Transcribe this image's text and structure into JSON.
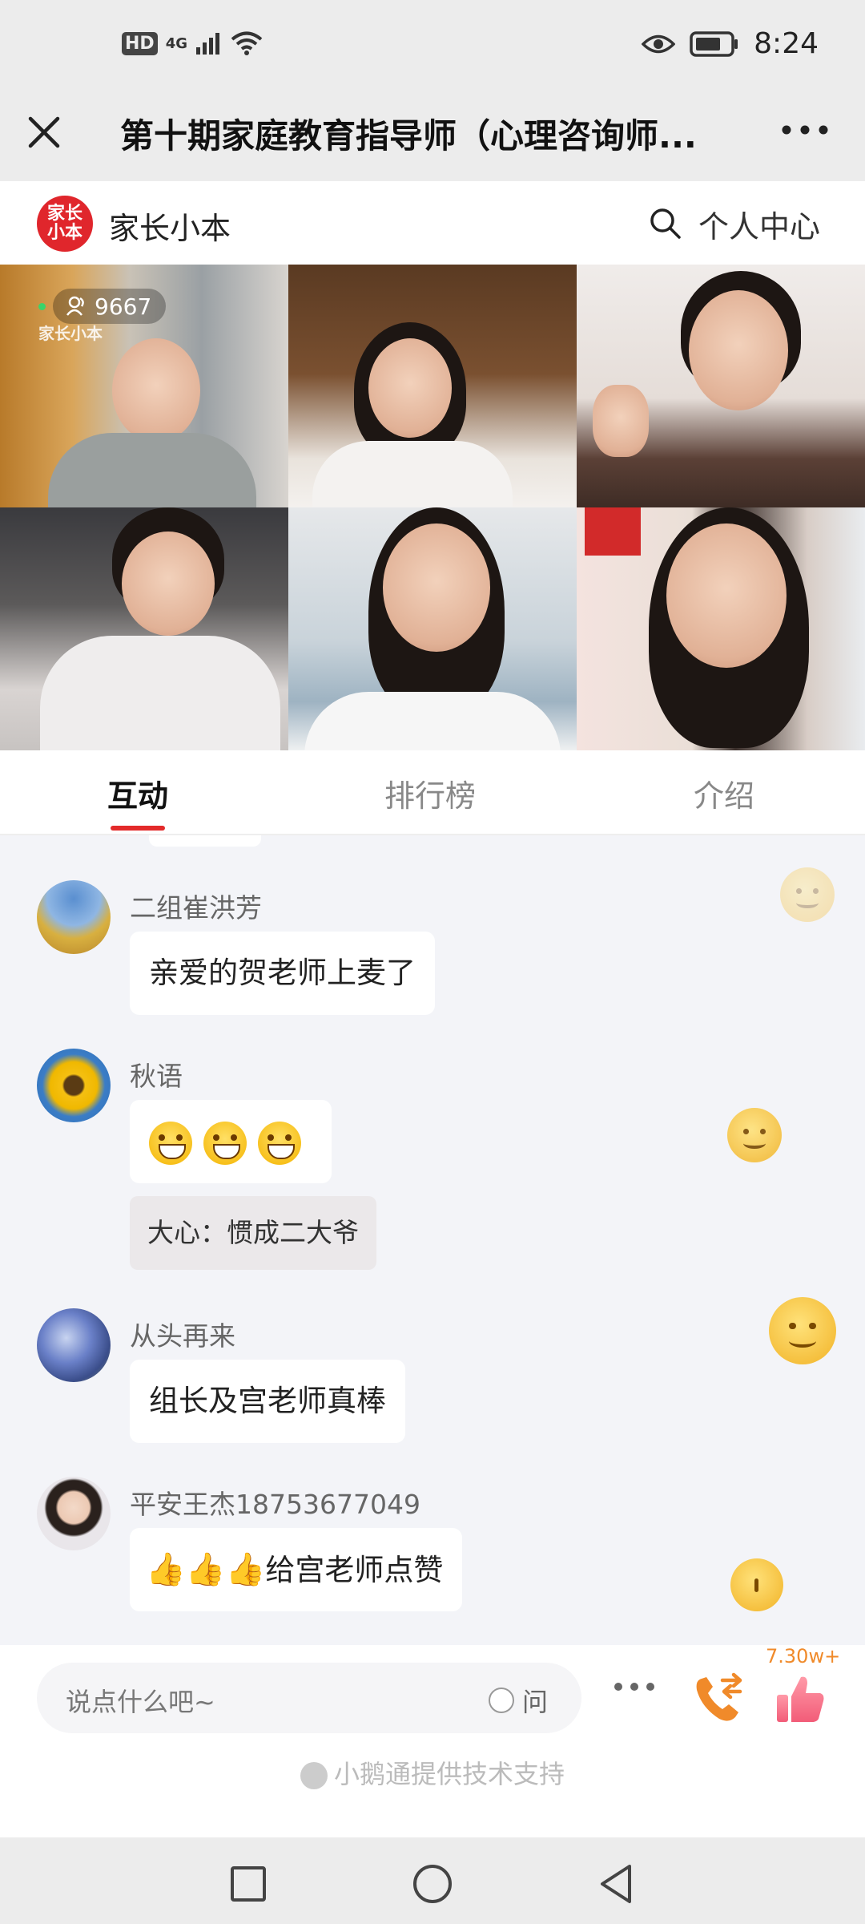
{
  "status_bar": {
    "hd": "HD",
    "network": "4G",
    "time": "8:24"
  },
  "title_bar": {
    "title": "第十期家庭教育指导师（心理咨询师..."
  },
  "header": {
    "logo_text_line1": "家长",
    "logo_text_line2": "小本",
    "brand_name": "家长小本",
    "personal_center": "个人中心"
  },
  "live": {
    "viewer_count": "9667",
    "watermark": "家长小本"
  },
  "tabs": [
    {
      "label": "互动",
      "active": true
    },
    {
      "label": "排行榜",
      "active": false
    },
    {
      "label": "介绍",
      "active": false
    }
  ],
  "messages": [
    {
      "user": "二组崔洪芳",
      "text": "亲爱的贺老师上麦了"
    },
    {
      "user": "秋语",
      "text": "😄😄😄",
      "reply": "大心：惯成二大爷"
    },
    {
      "user": "从头再来",
      "text": "组长及宫老师真棒"
    },
    {
      "user": "平安王杰18753677049",
      "text": "给宫老师点赞",
      "prefix_thumbs": "👍👍👍"
    }
  ],
  "input_bar": {
    "placeholder": "说点什么吧~",
    "ask_label": "问",
    "like_count": "7.30w+",
    "support_text": "小鹅通提供技术支持"
  },
  "icons": {
    "close": "close-icon",
    "more": "more-icon",
    "search": "search-icon",
    "phone": "phone-switch-icon",
    "like": "thumbs-up-icon"
  },
  "colors": {
    "accent_red": "#e32a2a",
    "brand_red": "#e0262c",
    "like_orange": "#f08a2a"
  }
}
